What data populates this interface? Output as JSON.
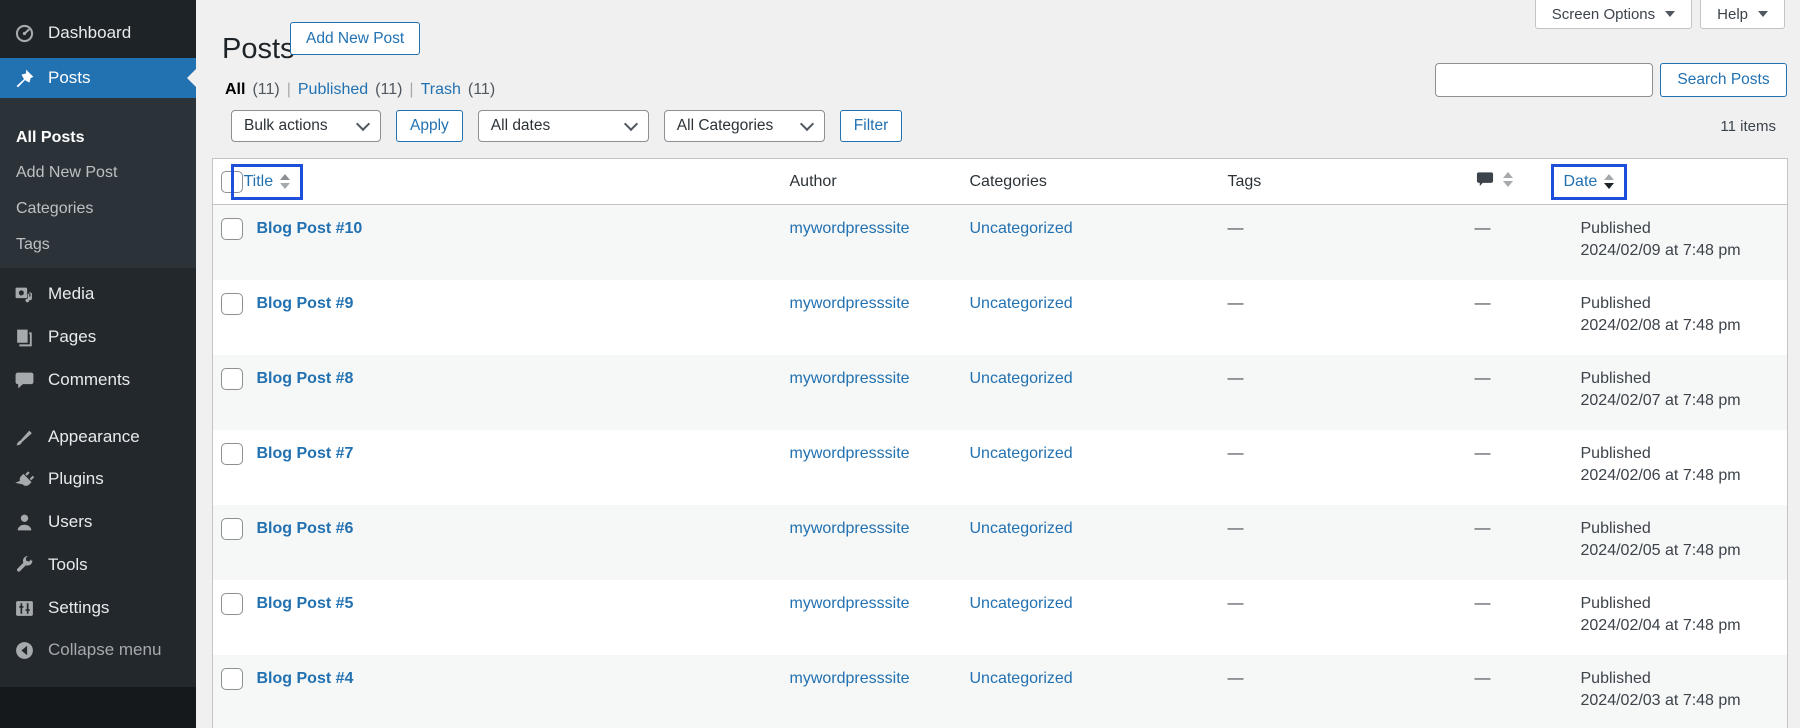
{
  "sidebar": {
    "dashboard": "Dashboard",
    "posts": "Posts",
    "all_posts": "All Posts",
    "add_new_post": "Add New Post",
    "categories": "Categories",
    "tags": "Tags",
    "media": "Media",
    "pages": "Pages",
    "comments": "Comments",
    "appearance": "Appearance",
    "plugins": "Plugins",
    "users": "Users",
    "tools": "Tools",
    "settings": "Settings",
    "collapse": "Collapse menu"
  },
  "header": {
    "title": "Posts",
    "add_new": "Add New Post",
    "screen_options": "Screen Options",
    "help": "Help"
  },
  "views": {
    "all": "All",
    "all_count": "(11)",
    "published": "Published",
    "published_count": "(11)",
    "trash": "Trash",
    "trash_count": "(11)",
    "sep": "|"
  },
  "toolbar": {
    "bulk_actions": "Bulk actions",
    "apply": "Apply",
    "all_dates": "All dates",
    "all_categories": "All Categories",
    "filter": "Filter",
    "search_value": "",
    "search_button": "Search Posts",
    "items_count": "11 items"
  },
  "table": {
    "headers": {
      "title": "Title",
      "author": "Author",
      "categories": "Categories",
      "tags": "Tags",
      "comments_icon": "comment-bubble",
      "date": "Date"
    },
    "rows": [
      {
        "title": "Blog Post #10",
        "author": "mywordpresssite",
        "category": "Uncategorized",
        "tags": "—",
        "comments": "—",
        "status": "Published",
        "date": "2024/02/09 at 7:48 pm"
      },
      {
        "title": "Blog Post #9",
        "author": "mywordpresssite",
        "category": "Uncategorized",
        "tags": "—",
        "comments": "—",
        "status": "Published",
        "date": "2024/02/08 at 7:48 pm"
      },
      {
        "title": "Blog Post #8",
        "author": "mywordpresssite",
        "category": "Uncategorized",
        "tags": "—",
        "comments": "—",
        "status": "Published",
        "date": "2024/02/07 at 7:48 pm"
      },
      {
        "title": "Blog Post #7",
        "author": "mywordpresssite",
        "category": "Uncategorized",
        "tags": "—",
        "comments": "—",
        "status": "Published",
        "date": "2024/02/06 at 7:48 pm"
      },
      {
        "title": "Blog Post #6",
        "author": "mywordpresssite",
        "category": "Uncategorized",
        "tags": "—",
        "comments": "—",
        "status": "Published",
        "date": "2024/02/05 at 7:48 pm"
      },
      {
        "title": "Blog Post #5",
        "author": "mywordpresssite",
        "category": "Uncategorized",
        "tags": "—",
        "comments": "—",
        "status": "Published",
        "date": "2024/02/04 at 7:48 pm"
      },
      {
        "title": "Blog Post #4",
        "author": "mywordpresssite",
        "category": "Uncategorized",
        "tags": "—",
        "comments": "—",
        "status": "Published",
        "date": "2024/02/03 at 7:48 pm"
      }
    ]
  },
  "colors": {
    "accent": "#2271b1",
    "highlight_box": "#1d4fdb",
    "sidebar_bg": "#23282d",
    "row_stripe": "#f6f7f7",
    "page_bg": "#f0f0f1"
  }
}
